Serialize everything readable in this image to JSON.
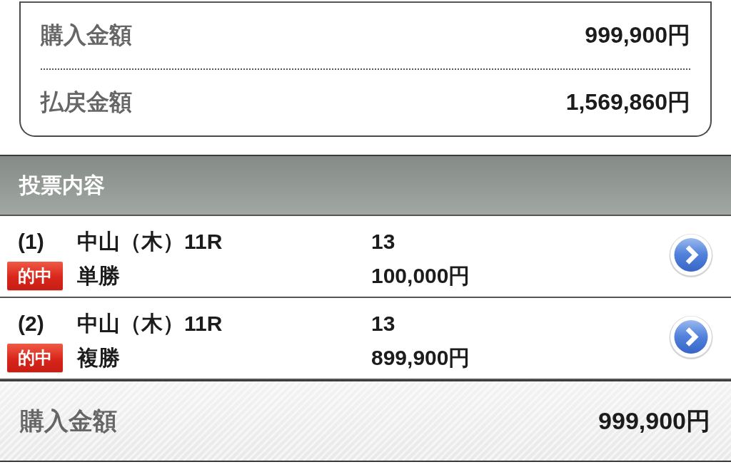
{
  "summary_card": {
    "rows": [
      {
        "label": "購入金額",
        "value": "999,900円"
      },
      {
        "label": "払戻金額",
        "value": "1,569,860円"
      }
    ]
  },
  "section_header": {
    "title": "投票内容"
  },
  "bets": [
    {
      "number": "(1)",
      "race": "中山（木）11R",
      "badge": "的中",
      "bet_type": "単勝",
      "horse": "13",
      "amount": "100,000円"
    },
    {
      "number": "(2)",
      "race": "中山（木）11R",
      "badge": "的中",
      "bet_type": "複勝",
      "horse": "13",
      "amount": "899,900円"
    }
  ],
  "total_bar": {
    "label": "購入金額",
    "value": "999,900円"
  }
}
